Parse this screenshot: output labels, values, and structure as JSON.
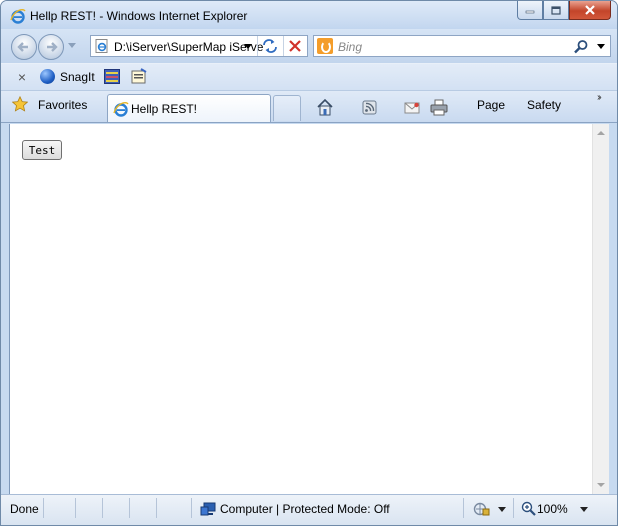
{
  "window": {
    "title": "Hellp REST! - Windows Internet Explorer"
  },
  "address_bar": {
    "url": "D:\\iServer\\SuperMap iServer",
    "icon": "ie-page-icon"
  },
  "search": {
    "placeholder": "Bing",
    "provider_icon": "bing-icon"
  },
  "toolbar": {
    "snagit_label": "SnagIt"
  },
  "favorites_bar": {
    "favorites_label": "Favorites",
    "tab_title": "Hellp REST!",
    "page_label": "Page",
    "safety_label": "Safety"
  },
  "content": {
    "test_button_label": "Test"
  },
  "status_bar": {
    "status": "Done",
    "zone": "Computer | Protected Mode: Off",
    "zoom": "100%"
  },
  "colors": {
    "frame": "#c7daf0",
    "close_button": "#c3452a",
    "bing": "#f49d2a"
  }
}
